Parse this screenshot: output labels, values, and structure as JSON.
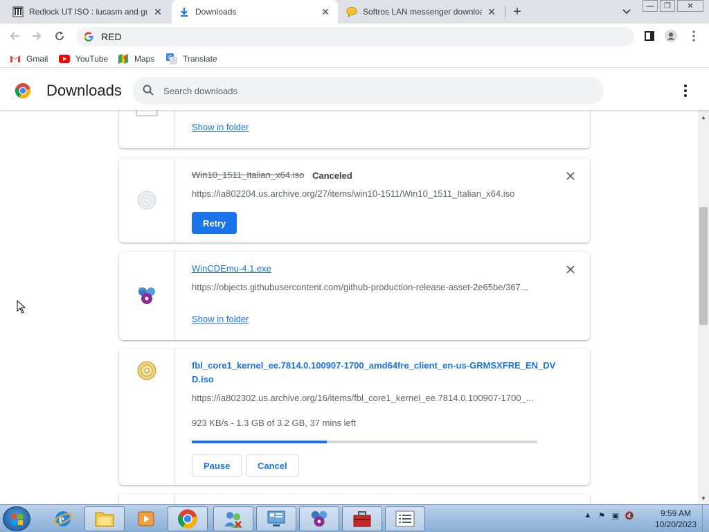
{
  "tabs": [
    {
      "title": "Redlock UT ISO : lucasm and gus",
      "icon": "archive-icon"
    },
    {
      "title": "Downloads",
      "icon": "download-icon"
    },
    {
      "title": "Softros LAN messenger downloa",
      "icon": "chat-bubble-icon"
    }
  ],
  "omnibox": {
    "value": "RED"
  },
  "bookmarks": [
    {
      "label": "Gmail",
      "icon": "gmail-icon"
    },
    {
      "label": "YouTube",
      "icon": "youtube-icon"
    },
    {
      "label": "Maps",
      "icon": "maps-icon"
    },
    {
      "label": "Translate",
      "icon": "translate-icon"
    }
  ],
  "downloads_page": {
    "title": "Downloads",
    "search_placeholder": "Search downloads"
  },
  "items": [
    {
      "show_in_folder": "Show in folder"
    },
    {
      "filename": "Win10_1511_Italian_x64.iso",
      "status": "Canceled",
      "url": "https://ia802204.us.archive.org/27/items/win10-1511/Win10_1511_Italian_x64.iso",
      "action": "Retry"
    },
    {
      "filename": "WinCDEmu-4.1.exe",
      "url": "https://objects.githubusercontent.com/github-production-release-asset-2e65be/367...",
      "show_in_folder": "Show in folder"
    },
    {
      "filename_line1": "fbl_core1_kernel_ee.7814.0.100907-1700_amd64fre_client_en-us-GRMSXFRE_EN_DV",
      "filename_line2": "D.iso",
      "url": "https://ia802302.us.archive.org/16/items/fbl_core1_kernel_ee.7814.0.100907-1700_...",
      "progress_text": "923 KB/s - 1.3 GB of 3.2 GB, 37 mins left",
      "progress_fraction": 0.39,
      "pause": "Pause",
      "cancel": "Cancel"
    }
  ],
  "clock": {
    "time": "9:59 AM",
    "date": "10/20/2023"
  },
  "colors": {
    "accent": "#1a73e8",
    "tabstrip": "#dee1e6"
  }
}
